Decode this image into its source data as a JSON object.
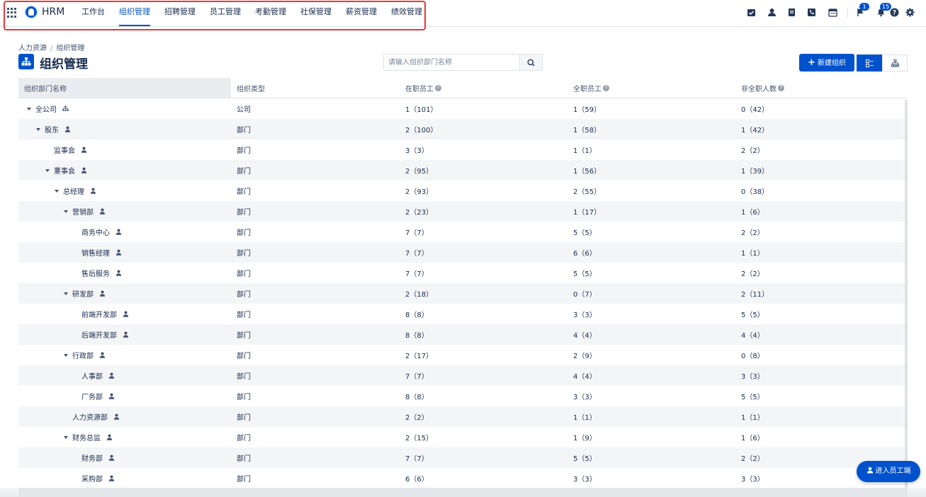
{
  "app": {
    "name": "HRM"
  },
  "nav": [
    {
      "label": "工作台",
      "active": false
    },
    {
      "label": "组织管理",
      "active": true
    },
    {
      "label": "招聘管理",
      "active": false
    },
    {
      "label": "员工管理",
      "active": false
    },
    {
      "label": "考勤管理",
      "active": false
    },
    {
      "label": "社保管理",
      "active": false
    },
    {
      "label": "薪资管理",
      "active": false
    },
    {
      "label": "绩效管理",
      "active": false
    }
  ],
  "header_icons": {
    "flag_badge": "1",
    "bell_badge": "15",
    "icons": [
      "task-icon",
      "user-icon",
      "document-icon",
      "contacts-icon",
      "calendar-icon",
      "flag-icon",
      "bell-icon",
      "help-icon",
      "settings-icon"
    ]
  },
  "breadcrumb": {
    "parent": "人力资源",
    "separator": "/",
    "current": "组织管理"
  },
  "page": {
    "title": "组织管理"
  },
  "search": {
    "placeholder": "请输入组织部门名称",
    "value": ""
  },
  "toolbar": {
    "new_label": "新建组织"
  },
  "table": {
    "headers": [
      "组织部门名称",
      "组织类型",
      "在职员工",
      "全职员工",
      "非全职人数"
    ],
    "rows": [
      {
        "name": "全公司",
        "type": "公司",
        "active": "1（101）",
        "fulltime": "1（59）",
        "parttime": "0（42）",
        "level": 0,
        "expand": true,
        "icon": "org-icon"
      },
      {
        "name": "股东",
        "type": "部门",
        "active": "2（100）",
        "fulltime": "1（58）",
        "parttime": "1（42）",
        "level": 1,
        "expand": true,
        "icon": "person-icon"
      },
      {
        "name": "监事会",
        "type": "部门",
        "active": "3（3）",
        "fulltime": "1（1）",
        "parttime": "2（2）",
        "level": 2,
        "expand": false,
        "icon": "person-icon"
      },
      {
        "name": "董事会",
        "type": "部门",
        "active": "2（95）",
        "fulltime": "1（56）",
        "parttime": "1（39）",
        "level": 2,
        "expand": true,
        "icon": "person-icon"
      },
      {
        "name": "总经理",
        "type": "部门",
        "active": "2（93）",
        "fulltime": "2（55）",
        "parttime": "0（38）",
        "level": 3,
        "expand": true,
        "icon": "person-icon"
      },
      {
        "name": "营销部",
        "type": "部门",
        "active": "2（23）",
        "fulltime": "1（17）",
        "parttime": "1（6）",
        "level": 4,
        "expand": true,
        "icon": "person-icon"
      },
      {
        "name": "商务中心",
        "type": "部门",
        "active": "7（7）",
        "fulltime": "5（5）",
        "parttime": "2（2）",
        "level": 5,
        "expand": false,
        "icon": "person-icon"
      },
      {
        "name": "销售经理",
        "type": "部门",
        "active": "7（7）",
        "fulltime": "6（6）",
        "parttime": "1（1）",
        "level": 5,
        "expand": false,
        "icon": "person-icon"
      },
      {
        "name": "售后服务",
        "type": "部门",
        "active": "7（7）",
        "fulltime": "5（5）",
        "parttime": "2（2）",
        "level": 5,
        "expand": false,
        "icon": "person-icon"
      },
      {
        "name": "研发部",
        "type": "部门",
        "active": "2（18）",
        "fulltime": "0（7）",
        "parttime": "2（11）",
        "level": 4,
        "expand": true,
        "icon": "person-icon"
      },
      {
        "name": "前端开发部",
        "type": "部门",
        "active": "8（8）",
        "fulltime": "3（3）",
        "parttime": "5（5）",
        "level": 5,
        "expand": false,
        "icon": "person-icon"
      },
      {
        "name": "后端开发部",
        "type": "部门",
        "active": "8（8）",
        "fulltime": "4（4）",
        "parttime": "4（4）",
        "level": 5,
        "expand": false,
        "icon": "person-icon"
      },
      {
        "name": "行政部",
        "type": "部门",
        "active": "2（17）",
        "fulltime": "2（9）",
        "parttime": "0（8）",
        "level": 4,
        "expand": true,
        "icon": "person-icon"
      },
      {
        "name": "人事部",
        "type": "部门",
        "active": "7（7）",
        "fulltime": "4（4）",
        "parttime": "3（3）",
        "level": 5,
        "expand": false,
        "icon": "person-icon"
      },
      {
        "name": "厂务部",
        "type": "部门",
        "active": "8（8）",
        "fulltime": "3（3）",
        "parttime": "5（5）",
        "level": 5,
        "expand": false,
        "icon": "person-icon"
      },
      {
        "name": "人力资源部",
        "type": "部门",
        "active": "2（2）",
        "fulltime": "1（1）",
        "parttime": "1（1）",
        "level": 4,
        "expand": false,
        "icon": "person-icon"
      },
      {
        "name": "财务总监",
        "type": "部门",
        "active": "2（15）",
        "fulltime": "1（9）",
        "parttime": "1（6）",
        "level": 4,
        "expand": true,
        "icon": "person-icon"
      },
      {
        "name": "财务部",
        "type": "部门",
        "active": "7（7）",
        "fulltime": "5（5）",
        "parttime": "2（2）",
        "level": 5,
        "expand": false,
        "icon": "person-icon"
      },
      {
        "name": "采购部",
        "type": "部门",
        "active": "6（6）",
        "fulltime": "3（3）",
        "parttime": "3（3）",
        "level": 5,
        "expand": false,
        "icon": "person-icon"
      }
    ]
  },
  "employee_portal": {
    "label": "进入员工端"
  },
  "colors": {
    "primary": "#0052cc",
    "highlight": "#e5383b",
    "row_alt": "#f4f5f7"
  }
}
